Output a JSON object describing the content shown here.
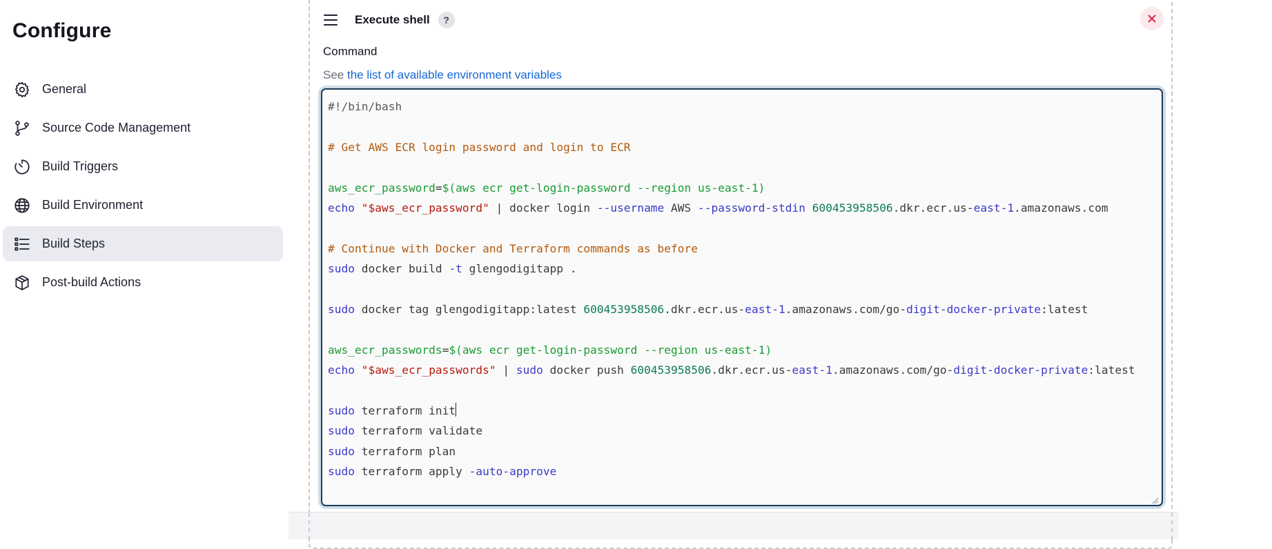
{
  "sidebar": {
    "title": "Configure",
    "items": [
      {
        "label": "General",
        "icon": "gear-icon",
        "active": false
      },
      {
        "label": "Source Code Management",
        "icon": "git-branch-icon",
        "active": false
      },
      {
        "label": "Build Triggers",
        "icon": "timer-icon",
        "active": false
      },
      {
        "label": "Build Environment",
        "icon": "globe-icon",
        "active": false
      },
      {
        "label": "Build Steps",
        "icon": "list-icon",
        "active": true
      },
      {
        "label": "Post-build Actions",
        "icon": "package-icon",
        "active": false
      }
    ]
  },
  "step": {
    "title": "Execute shell",
    "help_label": "?",
    "field_label": "Command",
    "hint_prefix": "See ",
    "hint_link": "the list of available environment variables"
  },
  "editor": {
    "lines": [
      [
        {
          "t": "shebang",
          "s": "#!/bin/bash"
        }
      ],
      [],
      [
        {
          "t": "comment",
          "s": "# Get AWS ECR login password and login to ECR"
        }
      ],
      [],
      [
        {
          "t": "var",
          "s": "aws_ecr_password"
        },
        {
          "t": "plain",
          "s": "="
        },
        {
          "t": "var",
          "s": "$(aws ecr get-login-password --region us-east-1)"
        }
      ],
      [
        {
          "t": "kw",
          "s": "echo "
        },
        {
          "t": "str",
          "s": "\"$aws_ecr_password\""
        },
        {
          "t": "plain",
          "s": " | docker login "
        },
        {
          "t": "kw",
          "s": "--username"
        },
        {
          "t": "plain",
          "s": " AWS "
        },
        {
          "t": "kw",
          "s": "--password-stdin"
        },
        {
          "t": "plain",
          "s": " "
        },
        {
          "t": "num",
          "s": "600453958506"
        },
        {
          "t": "plain",
          "s": ".dkr.ecr.us-"
        },
        {
          "t": "kw",
          "s": "east-1"
        },
        {
          "t": "plain",
          "s": ".amazonaws.com"
        }
      ],
      [],
      [
        {
          "t": "comment",
          "s": "# Continue with Docker and Terraform commands as before"
        }
      ],
      [
        {
          "t": "kw",
          "s": "sudo"
        },
        {
          "t": "plain",
          "s": " docker build "
        },
        {
          "t": "kw",
          "s": "-t"
        },
        {
          "t": "plain",
          "s": " glengodigitapp ."
        }
      ],
      [],
      [
        {
          "t": "kw",
          "s": "sudo"
        },
        {
          "t": "plain",
          "s": " docker tag glengodigitapp:latest "
        },
        {
          "t": "num",
          "s": "600453958506"
        },
        {
          "t": "plain",
          "s": ".dkr.ecr.us-"
        },
        {
          "t": "kw",
          "s": "east-1"
        },
        {
          "t": "plain",
          "s": ".amazonaws.com/go-"
        },
        {
          "t": "kw",
          "s": "digit-docker-private"
        },
        {
          "t": "plain",
          "s": ":latest"
        }
      ],
      [],
      [
        {
          "t": "var",
          "s": "aws_ecr_passwords"
        },
        {
          "t": "plain",
          "s": "="
        },
        {
          "t": "var",
          "s": "$(aws ecr get-login-password --region us-east-1)"
        }
      ],
      [
        {
          "t": "kw",
          "s": "echo "
        },
        {
          "t": "str",
          "s": "\"$aws_ecr_passwords\""
        },
        {
          "t": "plain",
          "s": " | "
        },
        {
          "t": "kw",
          "s": "sudo"
        },
        {
          "t": "plain",
          "s": " docker push "
        },
        {
          "t": "num",
          "s": "600453958506"
        },
        {
          "t": "plain",
          "s": ".dkr.ecr.us-"
        },
        {
          "t": "kw",
          "s": "east-1"
        },
        {
          "t": "plain",
          "s": ".amazonaws.com/go-"
        },
        {
          "t": "kw",
          "s": "digit-docker-private"
        },
        {
          "t": "plain",
          "s": ":latest"
        }
      ],
      [],
      [
        {
          "t": "kw",
          "s": "sudo"
        },
        {
          "t": "plain",
          "s": " terraform init"
        },
        {
          "t": "caret",
          "s": ""
        }
      ],
      [
        {
          "t": "kw",
          "s": "sudo"
        },
        {
          "t": "plain",
          "s": " terraform validate"
        }
      ],
      [
        {
          "t": "kw",
          "s": "sudo"
        },
        {
          "t": "plain",
          "s": " terraform plan"
        }
      ],
      [
        {
          "t": "kw",
          "s": "sudo"
        },
        {
          "t": "plain",
          "s": " terraform apply "
        },
        {
          "t": "kw",
          "s": "-auto-approve"
        }
      ]
    ]
  }
}
